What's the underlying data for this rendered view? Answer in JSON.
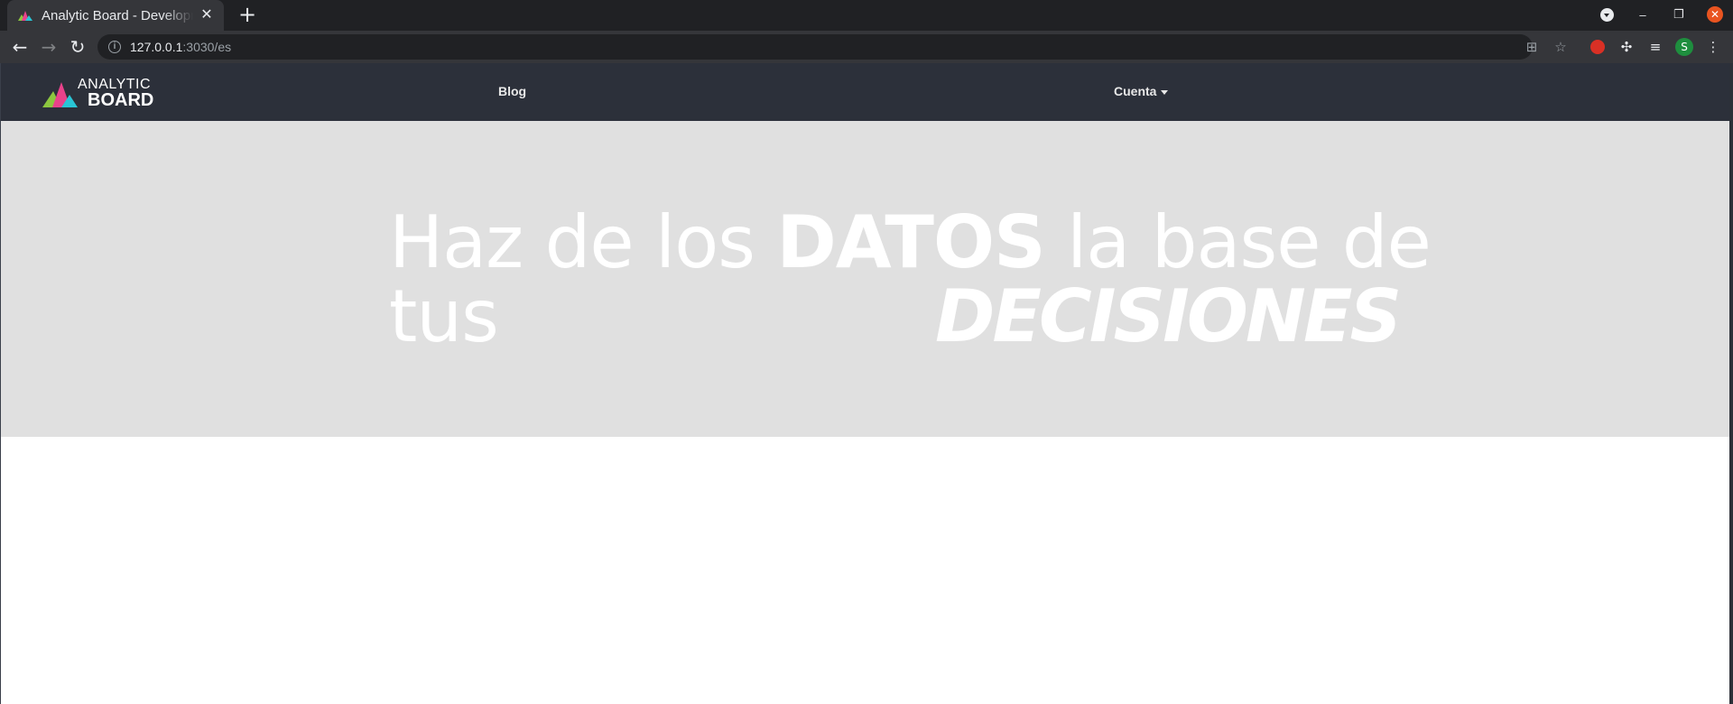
{
  "browser": {
    "tab": {
      "title": "Analytic Board - Development"
    },
    "address": {
      "host": "127.0.0.1",
      "rest": ":3030/es"
    },
    "profile_initial": "S"
  },
  "site": {
    "brand": {
      "line1": "ANALYTIC",
      "line2": "BOARD"
    },
    "nav": {
      "blog": "Blog",
      "account": "Cuenta"
    }
  },
  "hero": {
    "line1_pre": "Haz de los ",
    "line1_bold": "DATOS",
    "line1_post": " la base de",
    "line2": "tus",
    "emphasis": "DECISIONES"
  },
  "colors": {
    "navbar": "#2c303a",
    "hero_bg": "#e0e0e0",
    "hero_text": "#ffffff",
    "logo_green": "#8cc63f",
    "logo_pink": "#e9428b",
    "logo_cyan": "#29c5d6"
  }
}
